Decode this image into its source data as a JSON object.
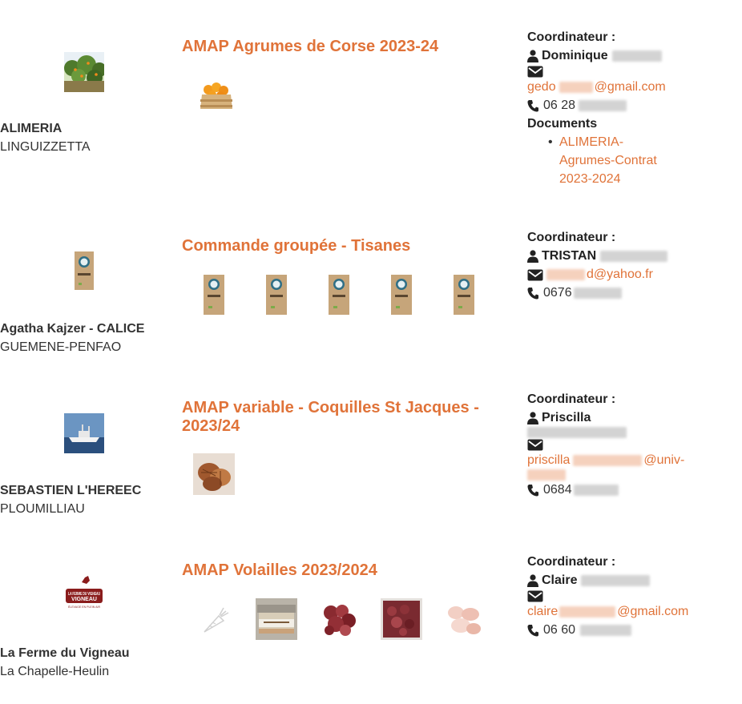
{
  "coordinator_label": "Coordinateur :",
  "documents_label": "Documents",
  "rows": [
    {
      "farm_name": "ALIMERIA",
      "farm_city": "LINGUIZZETTA",
      "contract_title": "AMAP Agrumes de Corse 2023-24",
      "products": [
        "crate-of-oranges"
      ],
      "coordinator_name": "Dominique",
      "email_prefix": "gedo",
      "email_suffix": "@gmail.com",
      "phone": "06 28",
      "documents": [
        "ALIMERIA-Agrumes-Contrat 2023-2024"
      ]
    },
    {
      "farm_name": "Agatha Kajzer - CALICE",
      "farm_city": "GUEMENE-PENFAO",
      "contract_title": "Commande groupée - Tisanes",
      "products": [
        "tisane-bag",
        "tisane-bag",
        "tisane-bag",
        "tisane-bag",
        "tisane-bag"
      ],
      "coordinator_name": "TRISTAN",
      "email_prefix": "",
      "email_suffix": "d@yahoo.fr",
      "phone": "0676"
    },
    {
      "farm_name": "SEBASTIEN L'HEREEC",
      "farm_city": "PLOUMILLIAU",
      "contract_title": "AMAP variable - Coquilles St Jacques - 2023/24",
      "products": [
        "scallops"
      ],
      "coordinator_name": "Priscilla",
      "email_prefix": "priscilla",
      "email_suffix": "@univ-",
      "phone": "0684"
    },
    {
      "farm_name": "La Ferme du Vigneau",
      "farm_city": "La Chapelle-Heulin",
      "contract_title": "AMAP Volailles 2023/2024",
      "products": [
        "carrot-placeholder",
        "rillettes-jar",
        "poultry-pieces",
        "poultry-gizzards",
        "whole-chicken-parts"
      ],
      "logo_text": "LA FERME DU VIGNEAU",
      "logo_subtext": "ÉLEVAGE EN PLEIN AIR",
      "coordinator_name": "Claire",
      "email_prefix": "claire",
      "email_suffix": "@gmail.com",
      "phone": "06 60"
    }
  ]
}
